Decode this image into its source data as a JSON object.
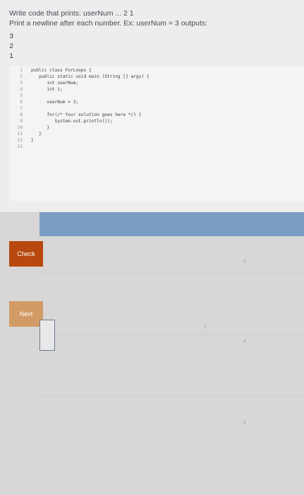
{
  "prompt": {
    "line1": "Write code that prints: userNum ... 2 1",
    "line2": "Print a newline after each number. Ex: userNum = 3 outputs:"
  },
  "sample_output": [
    "3",
    "2",
    "1"
  ],
  "editor": {
    "lines": [
      {
        "n": "1",
        "text": "public class ForLoops {"
      },
      {
        "n": "2",
        "text": "   public static void main (String [] args) {"
      },
      {
        "n": "3",
        "text": "      int userNum;"
      },
      {
        "n": "4",
        "text": "      int i;"
      },
      {
        "n": "5",
        "text": ""
      },
      {
        "n": "6",
        "text": "      userNum = 3;"
      },
      {
        "n": "7",
        "text": ""
      },
      {
        "n": "8",
        "text": "      for(/* Your solution goes here */) {"
      },
      {
        "n": "9",
        "text": "         System.out.println(i);"
      },
      {
        "n": "10",
        "text": "      }"
      },
      {
        "n": "11",
        "text": "   }"
      },
      {
        "n": "12",
        "text": "}"
      },
      {
        "n": "13",
        "text": ""
      }
    ]
  },
  "buttons": {
    "check": "Check",
    "next": "Next"
  },
  "progress": {
    "current": "2",
    "labels": [
      "1",
      "2",
      "3",
      "4",
      "5"
    ]
  }
}
